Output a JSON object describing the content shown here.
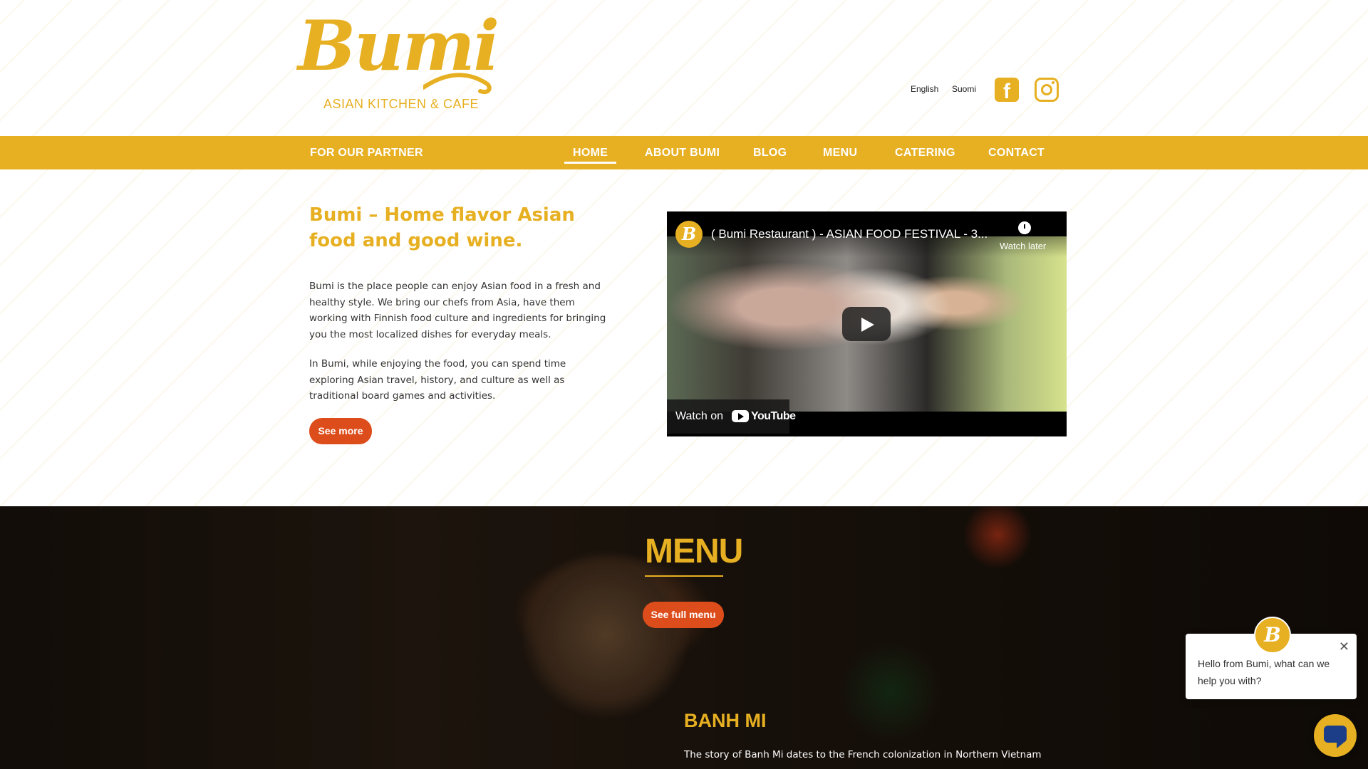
{
  "brand": {
    "name": "Bumi",
    "tagline": "ASIAN KITCHEN & CAFE",
    "accent_color": "#e7b022",
    "button_color": "#dd4d1b"
  },
  "header": {
    "languages": [
      "English",
      "Suomi"
    ],
    "social": [
      "facebook-icon",
      "instagram-icon"
    ]
  },
  "nav": {
    "partner": "FOR OUR PARTNER",
    "items": [
      "HOME",
      "ABOUT BUMI",
      "BLOG",
      "MENU",
      "CATERING",
      "CONTACT"
    ],
    "active": "HOME"
  },
  "intro": {
    "title": "Bumi – Home flavor Asian food and good wine.",
    "paragraph1": "Bumi is the place people can enjoy Asian food in a fresh and healthy style. We bring our chefs from Asia, have them working with Finnish food culture and ingredients for bringing you the most localized dishes for everyday meals.",
    "paragraph2": "In Bumi, while enjoying the food, you can spend time exploring Asian travel, history, and culture as well as traditional board games and activities.",
    "button": "See more"
  },
  "video": {
    "title": "( Bumi Restaurant ) - ASIAN FOOD FESTIVAL - 3...",
    "watch_later": "Watch later",
    "watch_on": "Watch on",
    "youtube": "YouTube"
  },
  "menu_section": {
    "title": "MENU",
    "button": "See full menu",
    "dish_title": "BANH MI",
    "dish_text": "The story of Banh Mi dates to the French colonization in Northern Vietnam"
  },
  "chat": {
    "message": "Hello from Bumi, what can we help you with?",
    "close": "✕"
  }
}
